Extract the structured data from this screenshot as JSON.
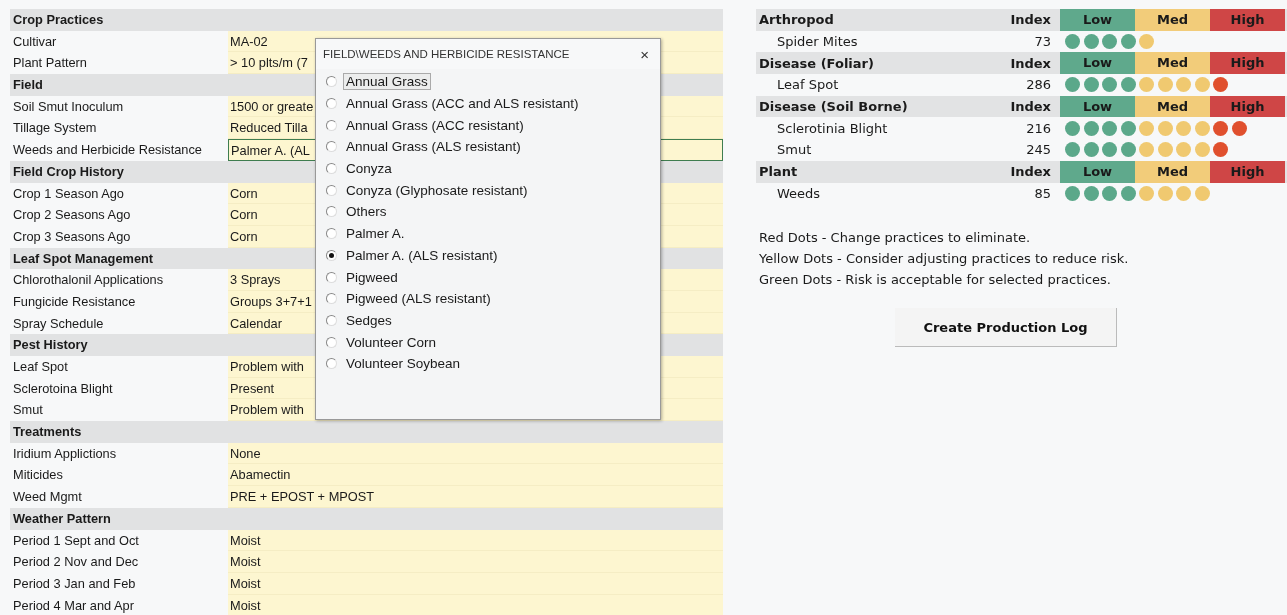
{
  "practices": [
    {
      "title": "Crop Practices",
      "rows": [
        {
          "label": "Cultivar",
          "value": "MA-02",
          "selected": false
        },
        {
          "label": "Plant Pattern",
          "value": "> 10 plts/m (7",
          "selected": false
        }
      ]
    },
    {
      "title": "Field",
      "rows": [
        {
          "label": "Soil Smut Inoculum",
          "value": "1500 or greate",
          "selected": false
        },
        {
          "label": "Tillage System",
          "value": "Reduced Tilla",
          "selected": false
        },
        {
          "label": "Weeds and Herbicide Resistance",
          "value": "Palmer A. (AL",
          "selected": true
        }
      ]
    },
    {
      "title": "Field Crop History",
      "rows": [
        {
          "label": "Crop 1 Season Ago",
          "value": "Corn",
          "selected": false
        },
        {
          "label": "Crop 2 Seasons Ago",
          "value": "Corn",
          "selected": false
        },
        {
          "label": "Crop 3 Seasons Ago",
          "value": "Corn",
          "selected": false
        }
      ]
    },
    {
      "title": "Leaf Spot Management",
      "rows": [
        {
          "label": "Chlorothalonil Applications",
          "value": "3 Sprays",
          "selected": false
        },
        {
          "label": "Fungicide Resistance",
          "value": "Groups 3+7+1",
          "selected": false
        },
        {
          "label": "Spray Schedule",
          "value": "Calendar",
          "selected": false
        }
      ]
    },
    {
      "title": "Pest History",
      "rows": [
        {
          "label": "Leaf Spot",
          "value": "Problem with",
          "selected": false
        },
        {
          "label": "Sclerotoina Blight",
          "value": "Present",
          "selected": false
        },
        {
          "label": "Smut",
          "value": "Problem with",
          "selected": false
        }
      ]
    },
    {
      "title": "Treatments",
      "rows": [
        {
          "label": "Iridium Applictions",
          "value": "None",
          "selected": false
        },
        {
          "label": "Miticides",
          "value": "Abamectin",
          "selected": false
        },
        {
          "label": "Weed Mgmt",
          "value": "PRE + EPOST + MPOST",
          "selected": false
        }
      ]
    },
    {
      "title": "Weather Pattern",
      "rows": [
        {
          "label": "Period 1 Sept and Oct",
          "value": "Moist",
          "selected": false
        },
        {
          "label": "Period 2 Nov and Dec",
          "value": "Moist",
          "selected": false
        },
        {
          "label": "Period 3 Jan and Feb",
          "value": "Moist",
          "selected": false
        },
        {
          "label": "Period 4 Mar and Apr",
          "value": "Moist",
          "selected": false
        }
      ]
    }
  ],
  "dialog": {
    "title": "FIELD\\WEEDS AND HERBICIDE RESISTANCE",
    "close": "×",
    "options": [
      {
        "label": "Annual Grass",
        "selected": false,
        "focused": true
      },
      {
        "label": "Annual Grass (ACC and ALS resistant)",
        "selected": false,
        "focused": false
      },
      {
        "label": "Annual Grass (ACC resistant)",
        "selected": false,
        "focused": false
      },
      {
        "label": "Annual Grass (ALS resistant)",
        "selected": false,
        "focused": false
      },
      {
        "label": "Conyza",
        "selected": false,
        "focused": false
      },
      {
        "label": "Conyza (Glyphosate resistant)",
        "selected": false,
        "focused": false
      },
      {
        "label": "Others",
        "selected": false,
        "focused": false
      },
      {
        "label": "Palmer A.",
        "selected": false,
        "focused": false
      },
      {
        "label": "Palmer A. (ALS resistant)",
        "selected": true,
        "focused": false
      },
      {
        "label": "Pigweed",
        "selected": false,
        "focused": false
      },
      {
        "label": "Pigweed (ALS resistant)",
        "selected": false,
        "focused": false
      },
      {
        "label": "Sedges",
        "selected": false,
        "focused": false
      },
      {
        "label": "Volunteer Corn",
        "selected": false,
        "focused": false
      },
      {
        "label": "Volunteer Soybean",
        "selected": false,
        "focused": false
      }
    ]
  },
  "risk_groups": [
    {
      "title": "Arthropod",
      "index_label": "Index",
      "levels": [
        {
          "label": "Low",
          "color": "#5fa98c"
        },
        {
          "label": "Med",
          "color": "#f2cc7a"
        },
        {
          "label": "High",
          "color": "#cf4646"
        }
      ],
      "items": [
        {
          "name": "Spider Mites",
          "index": "73",
          "dots": [
            {
              "color": "#5ba88a"
            },
            {
              "color": "#5ba88a"
            },
            {
              "color": "#5ba88a"
            },
            {
              "color": "#5ba88a"
            },
            {
              "color": "#f0c970"
            }
          ]
        }
      ]
    },
    {
      "title": "Disease (Foliar)",
      "index_label": "Index",
      "levels": [
        {
          "label": "Low",
          "color": "#5fa98c"
        },
        {
          "label": "Med",
          "color": "#f2cc7a"
        },
        {
          "label": "High",
          "color": "#cf4646"
        }
      ],
      "items": [
        {
          "name": "Leaf Spot",
          "index": "286",
          "dots": [
            {
              "color": "#5ba88a"
            },
            {
              "color": "#5ba88a"
            },
            {
              "color": "#5ba88a"
            },
            {
              "color": "#5ba88a"
            },
            {
              "color": "#f0c970"
            },
            {
              "color": "#f0c970"
            },
            {
              "color": "#f0c970"
            },
            {
              "color": "#f0c970"
            },
            {
              "color": "#e0502e"
            }
          ]
        }
      ]
    },
    {
      "title": "Disease (Soil Borne)",
      "index_label": "Index",
      "levels": [
        {
          "label": "Low",
          "color": "#5fa98c"
        },
        {
          "label": "Med",
          "color": "#f2cc7a"
        },
        {
          "label": "High",
          "color": "#cf4646"
        }
      ],
      "items": [
        {
          "name": "Sclerotinia Blight",
          "index": "216",
          "dots": [
            {
              "color": "#5ba88a"
            },
            {
              "color": "#5ba88a"
            },
            {
              "color": "#5ba88a"
            },
            {
              "color": "#5ba88a"
            },
            {
              "color": "#f0c970"
            },
            {
              "color": "#f0c970"
            },
            {
              "color": "#f0c970"
            },
            {
              "color": "#f0c970"
            },
            {
              "color": "#e0502e"
            },
            {
              "color": "#e0502e"
            }
          ]
        },
        {
          "name": "Smut",
          "index": "245",
          "dots": [
            {
              "color": "#5ba88a"
            },
            {
              "color": "#5ba88a"
            },
            {
              "color": "#5ba88a"
            },
            {
              "color": "#5ba88a"
            },
            {
              "color": "#f0c970"
            },
            {
              "color": "#f0c970"
            },
            {
              "color": "#f0c970"
            },
            {
              "color": "#f0c970"
            },
            {
              "color": "#e0502e"
            }
          ]
        }
      ]
    },
    {
      "title": "Plant",
      "index_label": "Index",
      "levels": [
        {
          "label": "Low",
          "color": "#5fa98c"
        },
        {
          "label": "Med",
          "color": "#f2cc7a"
        },
        {
          "label": "High",
          "color": "#cf4646"
        }
      ],
      "items": [
        {
          "name": "Weeds",
          "index": "85",
          "dots": [
            {
              "color": "#5ba88a"
            },
            {
              "color": "#5ba88a"
            },
            {
              "color": "#5ba88a"
            },
            {
              "color": "#5ba88a"
            },
            {
              "color": "#f0c970"
            },
            {
              "color": "#f0c970"
            },
            {
              "color": "#f0c970"
            },
            {
              "color": "#f0c970"
            }
          ]
        }
      ]
    }
  ],
  "notes": [
    "Red Dots - Change practices to eliminate.",
    "Yellow Dots - Consider adjusting practices to reduce risk.",
    "Green Dots - Risk is acceptable for selected practices."
  ],
  "button": "Create Production Log"
}
